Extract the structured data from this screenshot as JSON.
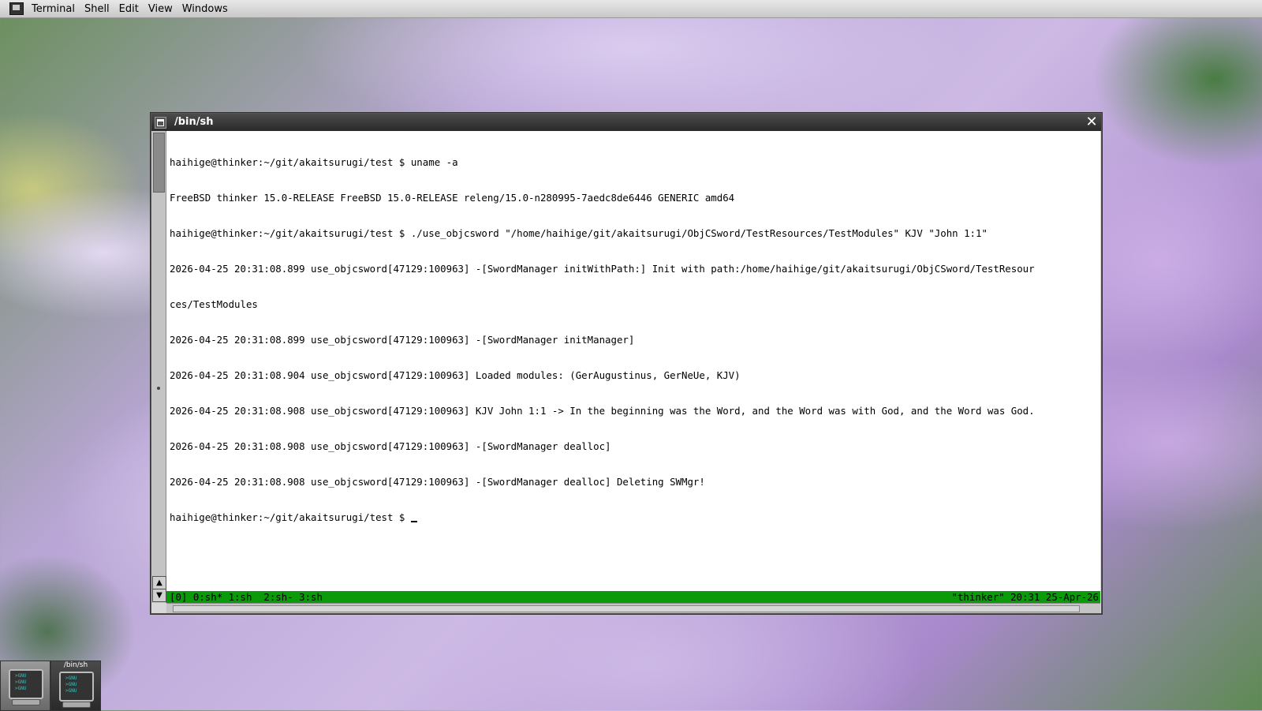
{
  "menubar": {
    "items": [
      "Terminal",
      "Shell",
      "Edit",
      "View",
      "Windows"
    ]
  },
  "window": {
    "title": "/bin/sh",
    "close_glyph": "✕"
  },
  "terminal": {
    "lines": [
      "haihige@thinker:~/git/akaitsurugi/test $ uname -a",
      "FreeBSD thinker 15.0-RELEASE FreeBSD 15.0-RELEASE releng/15.0-n280995-7aedc8de6446 GENERIC amd64",
      "haihige@thinker:~/git/akaitsurugi/test $ ./use_objcsword \"/home/haihige/git/akaitsurugi/ObjCSword/TestResources/TestModules\" KJV \"John 1:1\"",
      "2026-04-25 20:31:08.899 use_objcsword[47129:100963] -[SwordManager initWithPath:] Init with path:/home/haihige/git/akaitsurugi/ObjCSword/TestResour",
      "ces/TestModules",
      "2026-04-25 20:31:08.899 use_objcsword[47129:100963] -[SwordManager initManager]",
      "2026-04-25 20:31:08.904 use_objcsword[47129:100963] Loaded modules: (GerAugustinus, GerNeUe, KJV)",
      "2026-04-25 20:31:08.908 use_objcsword[47129:100963] KJV John 1:1 -> In the beginning was the Word, and the Word was with God, and the Word was God.",
      "2026-04-25 20:31:08.908 use_objcsword[47129:100963] -[SwordManager dealloc]",
      "2026-04-25 20:31:08.908 use_objcsword[47129:100963] -[SwordManager dealloc] Deleting SWMgr!"
    ],
    "prompt": "haihige@thinker:~/git/akaitsurugi/test $ ",
    "status_left": "[0] 0:sh* 1:sh  2:sh- 3:sh",
    "status_right": "\"thinker\" 20:31 25-Apr-26"
  },
  "scrollbar": {
    "up_glyph": "▲",
    "down_glyph": "▼"
  },
  "dock": {
    "tiles": [
      {
        "label": "",
        "screen_lines": [
          ">GNU",
          ">GNU",
          ">GNU"
        ]
      },
      {
        "label": "/bin/sh",
        "screen_lines": [
          ">GNU",
          ">GNU",
          ">GNU"
        ]
      }
    ]
  },
  "colors": {
    "status_bar": "#0a9a0a",
    "title_bar": "#2a2a2a",
    "terminal_bg": "#ffffff"
  }
}
